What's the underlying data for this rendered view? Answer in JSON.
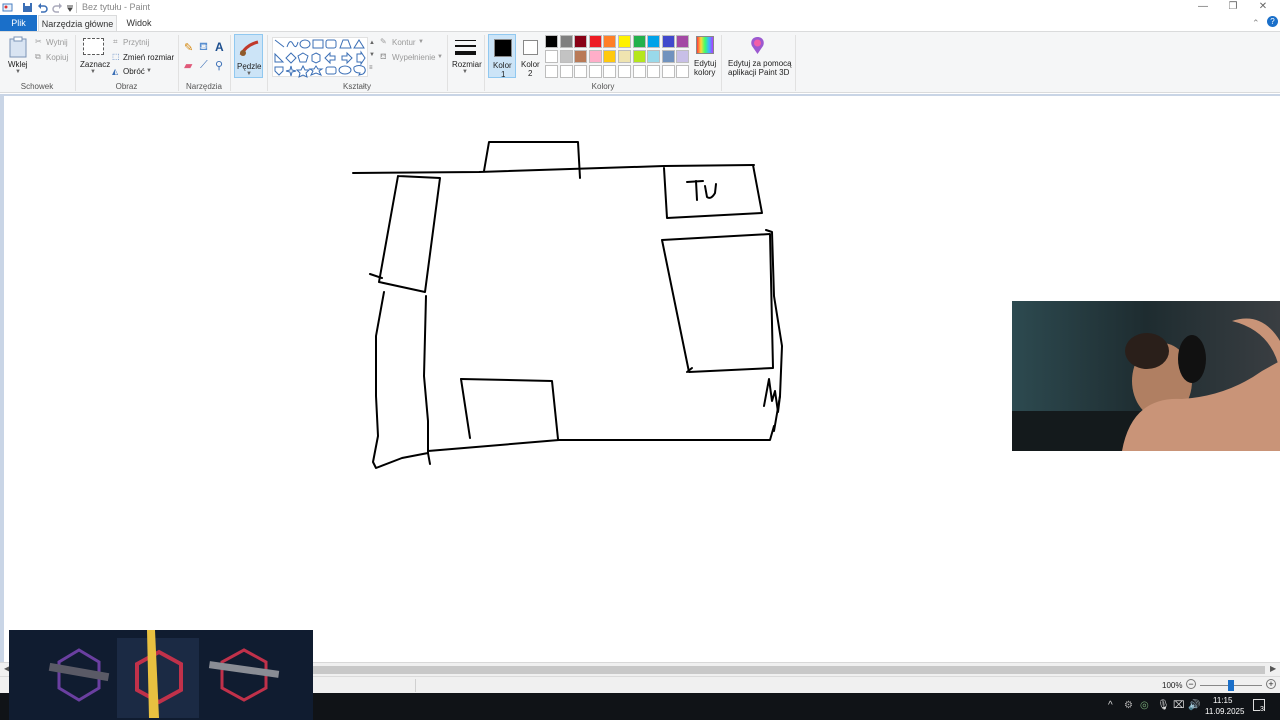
{
  "window": {
    "title": "Bez tytułu - Paint",
    "controls": {
      "minimize": "—",
      "maximize": "❐",
      "close": "✕"
    }
  },
  "tabs": {
    "file": "Plik",
    "home": "Narzędzia główne",
    "view": "Widok"
  },
  "ribbon": {
    "clipboard": {
      "paste": "Wklej",
      "cut": "Wytnij",
      "copy": "Kopiuj",
      "group": "Schowek"
    },
    "image": {
      "select": "Zaznacz",
      "crop": "Przytnij",
      "resize": "Zmień rozmiar",
      "rotate": "Obróć",
      "group": "Obraz"
    },
    "tools": {
      "group": "Narzędzia"
    },
    "brushes": {
      "label": "Pędzle"
    },
    "shapes": {
      "outline": "Kontur",
      "fill": "Wypełnienie",
      "group": "Kształty"
    },
    "size": {
      "label": "Rozmiar"
    },
    "colors": {
      "color1": "Kolor",
      "color1_num": "1",
      "color2": "Kolor",
      "color2_num": "2",
      "edit": "Edytuj",
      "edit2": "kolory",
      "paint3d": "Edytuj za pomocą",
      "paint3d2": "aplikacji Paint 3D",
      "group": "Kolory",
      "color1_value": "#000000",
      "color2_value": "#ffffff",
      "palette_row1": [
        "#000000",
        "#7f7f7f",
        "#880015",
        "#ed1c24",
        "#ff7f27",
        "#fff200",
        "#22b14c",
        "#00a2e8",
        "#3f48cc",
        "#a349a4"
      ],
      "palette_row2": [
        "#ffffff",
        "#c3c3c3",
        "#b97a57",
        "#ffaec9",
        "#ffc90e",
        "#efe4b0",
        "#b5e61d",
        "#99d9ea",
        "#7092be",
        "#c8bfe7"
      ]
    }
  },
  "canvas": {
    "drawing_text": "Tu"
  },
  "status": {
    "zoom": "100%"
  },
  "taskbar": {
    "time": "11:15",
    "date": "11.09.2025",
    "notifications": "3"
  }
}
